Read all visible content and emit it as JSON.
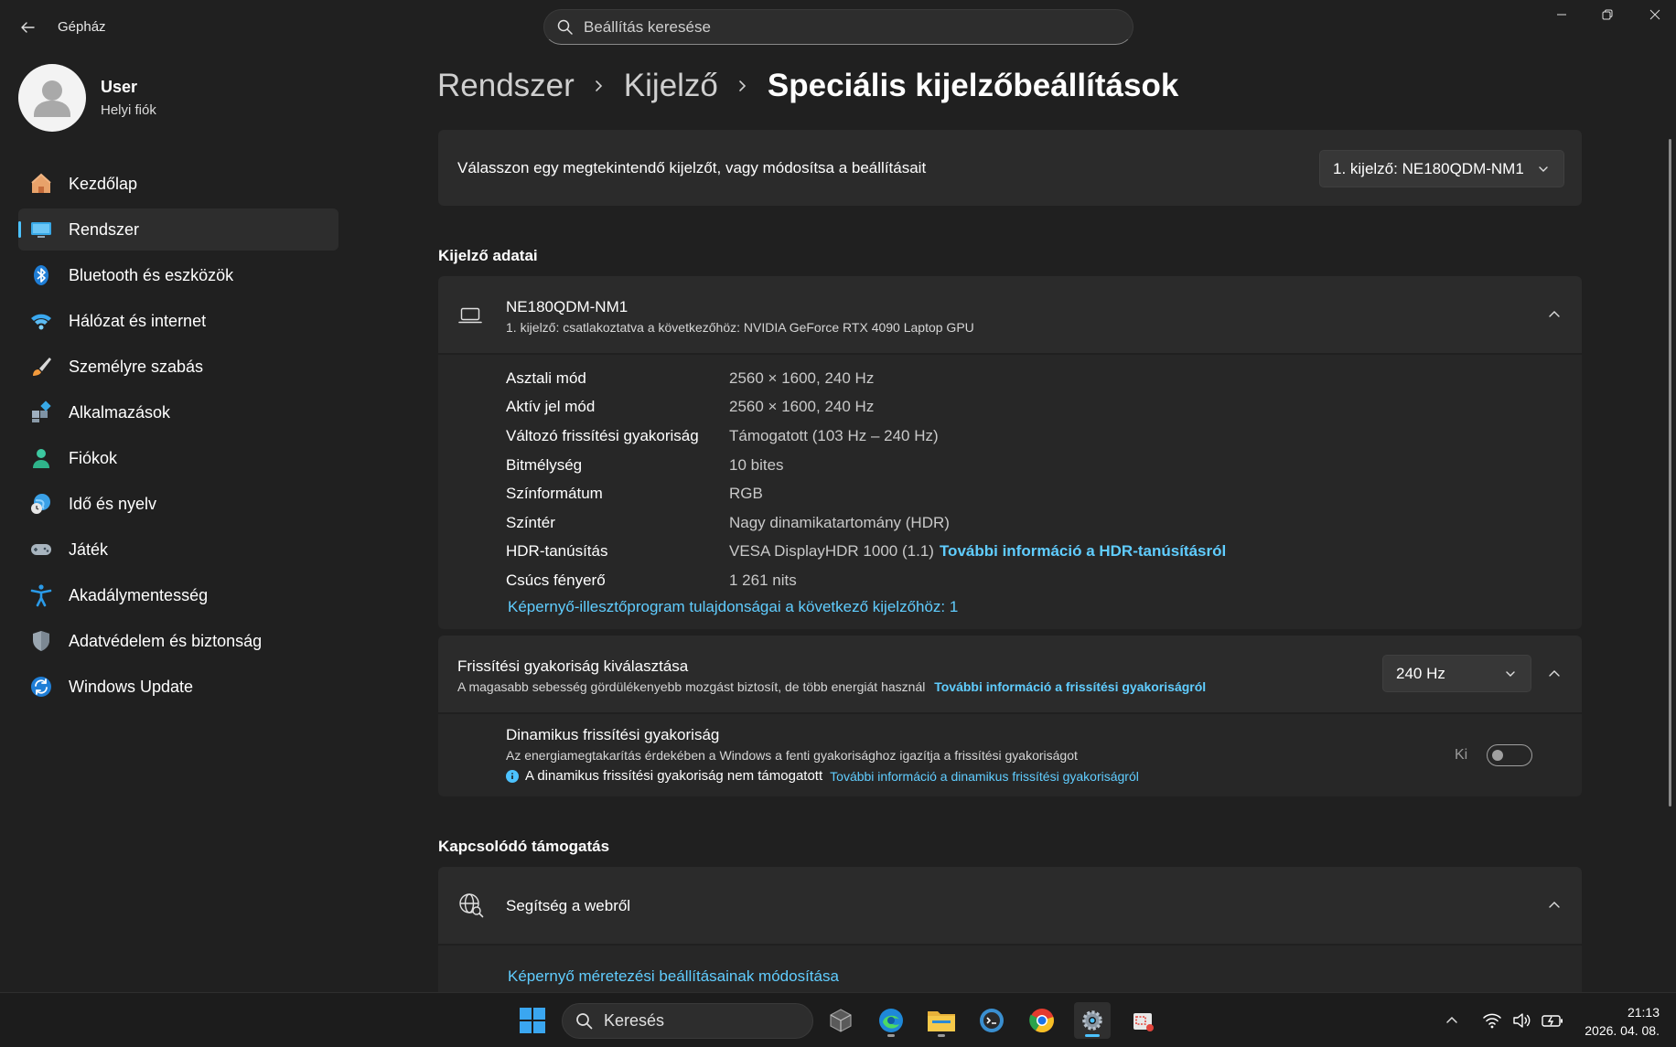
{
  "window": {
    "title": "Gépház",
    "controls": {
      "minimize": "minimize",
      "maximize": "restore",
      "close": "close"
    }
  },
  "search": {
    "placeholder": "Beállítás keresése"
  },
  "profile": {
    "name": "User",
    "account_type": "Helyi fiók"
  },
  "nav": {
    "items": [
      {
        "label": "Kezdőlap",
        "icon": "home-icon"
      },
      {
        "label": "Rendszer",
        "icon": "monitor-icon",
        "active": true
      },
      {
        "label": "Bluetooth és eszközök",
        "icon": "bluetooth-icon"
      },
      {
        "label": "Hálózat és internet",
        "icon": "wifi-icon"
      },
      {
        "label": "Személyre szabás",
        "icon": "brush-icon"
      },
      {
        "label": "Alkalmazások",
        "icon": "apps-icon"
      },
      {
        "label": "Fiókok",
        "icon": "person-icon"
      },
      {
        "label": "Idő és nyelv",
        "icon": "globe-clock-icon"
      },
      {
        "label": "Játék",
        "icon": "gamepad-icon"
      },
      {
        "label": "Akadálymentesség",
        "icon": "accessibility-icon"
      },
      {
        "label": "Adatvédelem és biztonság",
        "icon": "shield-icon"
      },
      {
        "label": "Windows Update",
        "icon": "update-icon"
      }
    ]
  },
  "breadcrumb": {
    "level1": "Rendszer",
    "level2": "Kijelző",
    "current": "Speciális kijelzőbeállítások"
  },
  "display_select": {
    "label": "Válasszon egy megtekintendő kijelzőt, vagy módosítsa a beállításait",
    "value": "1. kijelző: NE180QDM-NM1"
  },
  "display_info": {
    "section_title": "Kijelző adatai",
    "name": "NE180QDM-NM1",
    "subtitle": "1. kijelző: csatlakoztatva a következőhöz: NVIDIA GeForce RTX 4090 Laptop GPU",
    "properties": [
      {
        "label": "Asztali mód",
        "value": "2560 × 1600, 240 Hz"
      },
      {
        "label": "Aktív jel mód",
        "value": "2560 × 1600, 240 Hz"
      },
      {
        "label": "Változó frissítési gyakoriság",
        "value": "Támogatott (103 Hz – 240 Hz)"
      },
      {
        "label": "Bitmélység",
        "value": "10 bites"
      },
      {
        "label": "Színformátum",
        "value": "RGB"
      },
      {
        "label": "Színtér",
        "value": "Nagy dinamikatartomány (HDR)"
      },
      {
        "label": "HDR-tanúsítás",
        "value": "VESA DisplayHDR 1000 (1.1)",
        "link": "További információ a HDR-tanúsításról"
      },
      {
        "label": "Csúcs fényerő",
        "value": "1 261 nits"
      }
    ],
    "adapter_link": "Képernyő-illesztőprogram tulajdonságai a következő kijelzőhöz: 1"
  },
  "refresh_rate": {
    "title": "Frissítési gyakoriság kiválasztása",
    "description": "A magasabb sebesség gördülékenyebb mozgást biztosít, de több energiát használ",
    "link": "További információ a frissítési gyakoriságról",
    "value": "240 Hz"
  },
  "dynamic_refresh": {
    "title": "Dinamikus frissítési gyakoriság",
    "description": "Az energiamegtakarítás érdekében a Windows a fenti gyakorisághoz igazítja a frissítési gyakoriságot",
    "note": "A dinamikus frissítési gyakoriság nem támogatott",
    "link": "További információ a dinamikus frissítési gyakoriságról",
    "toggle_label": "Ki",
    "toggle_on": false
  },
  "related": {
    "section_title": "Kapcsolódó támogatás",
    "web_help": "Segítség a webről",
    "scaling_link": "Képernyő méretezési beállításainak módosítása"
  },
  "taskbar": {
    "search_label": "Keresés",
    "time": "21:13",
    "date": "2026. 04. 08."
  },
  "colors": {
    "accent": "#60cdff",
    "background": "#202020",
    "card": "#2b2b2b",
    "taskbar": "#1c1c1c"
  }
}
